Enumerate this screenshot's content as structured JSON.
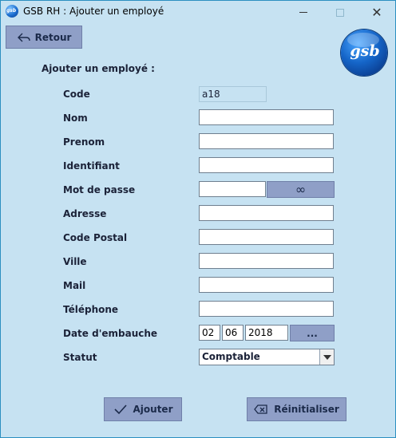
{
  "window": {
    "title": "GSB RH : Ajouter un employé",
    "app_icon_text": "gsb"
  },
  "toolbar": {
    "back_label": "Retour"
  },
  "logo": {
    "text": "gsb"
  },
  "form": {
    "section_title": "Ajouter un employé :",
    "fields": [
      {
        "label": "Code",
        "value": "a18",
        "readonly": true
      },
      {
        "label": "Nom",
        "value": ""
      },
      {
        "label": "Prenom",
        "value": ""
      },
      {
        "label": "Identifiant",
        "value": ""
      },
      {
        "label": "Mot de passe",
        "value": ""
      },
      {
        "label": "Adresse",
        "value": ""
      },
      {
        "label": "Code Postal",
        "value": ""
      },
      {
        "label": "Ville",
        "value": ""
      },
      {
        "label": "Mail",
        "value": ""
      },
      {
        "label": "Téléphone",
        "value": ""
      },
      {
        "label": "Date d'embauche",
        "value": ""
      },
      {
        "label": "Statut",
        "value": "Comptable"
      }
    ],
    "password_toggle_glyph": "∞",
    "date": {
      "day": "02",
      "month": "06",
      "year": "2018",
      "picker_label": "..."
    },
    "statut_selected": "Comptable"
  },
  "actions": {
    "add_label": "Ajouter",
    "reset_label": "Réinitialiser"
  },
  "colors": {
    "background": "#c6e2f2",
    "button": "#8f9fc7",
    "logo": "#1565c8"
  }
}
